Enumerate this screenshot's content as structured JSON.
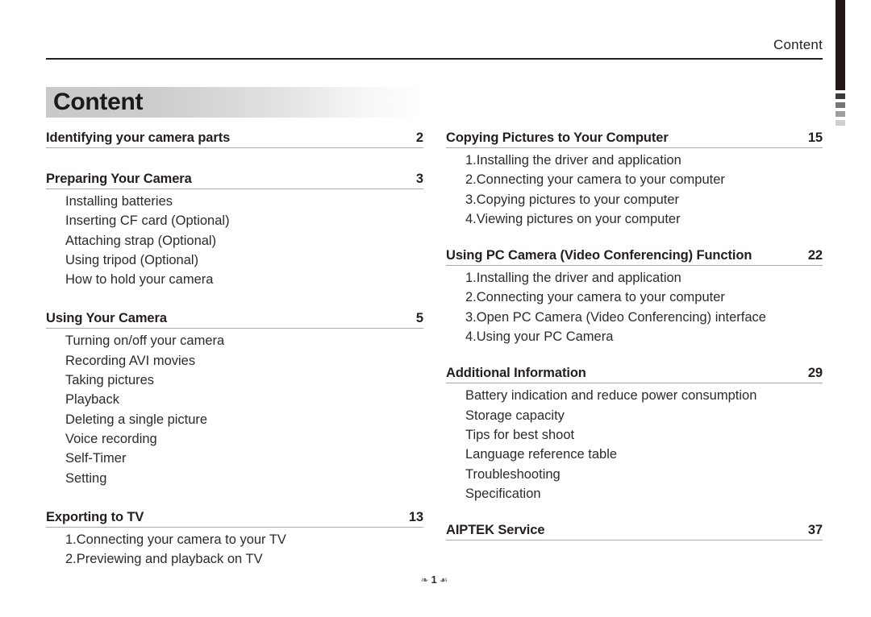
{
  "page": {
    "running_head": "Content",
    "title": "Content",
    "footer": {
      "ornament_left": "❧",
      "page_number": "1",
      "ornament_right": "☙"
    }
  },
  "edge_tab": {
    "name": "page-edge-tab",
    "bar_color": "#231715",
    "squares": [
      "#3e3a39",
      "#767676",
      "#9e9e9e",
      "#cfcfcf"
    ]
  },
  "columns": {
    "left": [
      {
        "title": "Identifying your camera parts",
        "page": "2",
        "items": []
      },
      {
        "title": "Preparing Your Camera",
        "page": "3",
        "items": [
          "Installing batteries",
          "Inserting CF card (Optional)",
          "Attaching strap (Optional)",
          "Using tripod (Optional)",
          "How to hold your camera"
        ]
      },
      {
        "title": "Using Your Camera",
        "page": "5",
        "items": [
          "Turning on/off your camera",
          "Recording AVI movies",
          "Taking pictures",
          "Playback",
          "Deleting a single picture",
          "Voice recording",
          "Self-Timer",
          "Setting"
        ]
      },
      {
        "title": "Exporting to TV",
        "page": "13",
        "items": [
          "1.Connecting your camera to your TV",
          "2.Previewing and playback on TV"
        ]
      }
    ],
    "right": [
      {
        "title": "Copying Pictures to Your Computer",
        "page": "15",
        "items": [
          "1.Installing the driver and application",
          "2.Connecting your camera to your computer",
          "3.Copying pictures to your computer",
          "4.Viewing pictures on your computer"
        ]
      },
      {
        "title": "Using PC Camera (Video Conferencing) Function",
        "page": "22",
        "items": [
          "1.Installing the driver and application",
          "2.Connecting your camera to your computer",
          "3.Open PC Camera (Video Conferencing) interface",
          "4.Using your PC Camera"
        ]
      },
      {
        "title": "Additional Information",
        "page": "29",
        "items": [
          "Battery indication and reduce power consumption",
          "Storage capacity",
          "Tips for best shoot",
          "Language reference table",
          "Troubleshooting",
          "Specification"
        ]
      },
      {
        "title": "AIPTEK Service",
        "page": "37",
        "items": []
      }
    ]
  }
}
